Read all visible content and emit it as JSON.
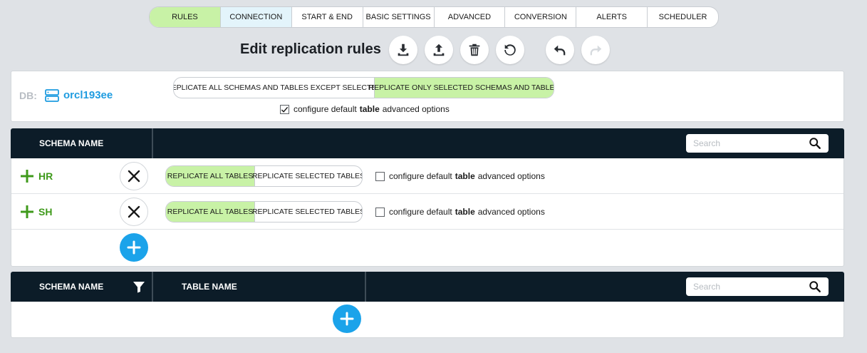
{
  "tabs": [
    {
      "label": "RULES",
      "state": "active"
    },
    {
      "label": "CONNECTION",
      "state": "hover"
    },
    {
      "label": "START & END",
      "state": ""
    },
    {
      "label": "BASIC SETTINGS",
      "state": ""
    },
    {
      "label": "ADVANCED",
      "state": ""
    },
    {
      "label": "CONVERSION",
      "state": ""
    },
    {
      "label": "ALERTS",
      "state": ""
    },
    {
      "label": "SCHEDULER",
      "state": ""
    }
  ],
  "page": {
    "title": "Edit replication rules",
    "toolbar_icons": [
      "download-icon",
      "upload-icon",
      "trash-icon",
      "refresh-icon",
      "undo-icon",
      "redo-icon"
    ]
  },
  "db": {
    "label": "DB:",
    "name": "orcl193ee",
    "mode_options": [
      "REPLICATE ALL SCHEMAS AND TABLES EXCEPT SELECTED",
      "REPLICATE ONLY SELECTED SCHEMAS AND TABLES"
    ],
    "mode_selected": "REPLICATE ONLY SELECTED SCHEMAS AND TABLES",
    "configure_checked": true,
    "configure_pre": "configure default",
    "configure_bold": "table",
    "configure_post": "advanced options"
  },
  "schemas_table": {
    "header": "SCHEMA NAME",
    "search_placeholder": "Search",
    "rows": [
      {
        "name": "HR",
        "options": [
          "REPLICATE ALL TABLES",
          "REPLICATE SELECTED TABLES"
        ],
        "selected": "REPLICATE ALL TABLES",
        "configure_checked": false
      },
      {
        "name": "SH",
        "options": [
          "REPLICATE ALL TABLES",
          "REPLICATE SELECTED TABLES"
        ],
        "selected": "REPLICATE ALL TABLES",
        "configure_checked": false
      }
    ],
    "configure_pre": "configure default",
    "configure_bold": "table",
    "configure_post": "advanced options"
  },
  "tables_table": {
    "schema_header": "SCHEMA NAME",
    "table_header": "TABLE NAME",
    "search_placeholder": "Search"
  },
  "colors": {
    "accent_green": "#c8f2a6",
    "schema_green": "#3f9a1b",
    "link_blue": "#1f9ce0",
    "add_blue": "#1ba3ea",
    "header_dark": "#0c1c28"
  }
}
